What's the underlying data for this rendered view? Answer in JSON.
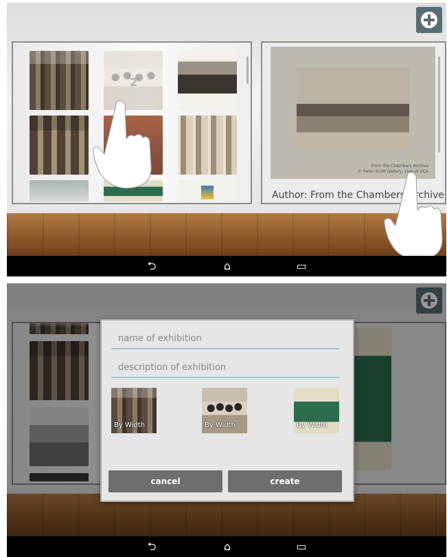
{
  "screen_top": {
    "author_label": "Author: From the Chambers Archive",
    "selection_number": "2",
    "check_mark": "✓",
    "photo_caption_line1": "From the Chambers Archive",
    "photo_caption_line2": "© Peter Scott Gallery, Live at UCA"
  },
  "screen_bottom": {
    "dialog": {
      "name_placeholder": "name of exhibition",
      "description_placeholder": "description of exhibition",
      "thumbnails": [
        {
          "label": "By Width"
        },
        {
          "label": "By Width"
        },
        {
          "label": "By Width"
        }
      ],
      "cancel_label": "cancel",
      "create_label": "create"
    }
  },
  "navbar": {
    "back_glyph": "⮌",
    "home_glyph": "⌂",
    "recents_glyph": "▭"
  },
  "icons": [
    "plus-icon",
    "hand-pointer-icon",
    "back-icon",
    "home-icon",
    "recents-icon",
    "checkmark-icon"
  ],
  "colors": {
    "accent": "#5a6d74",
    "check": "#8bc34a",
    "field_line": "#9fc4cf"
  }
}
